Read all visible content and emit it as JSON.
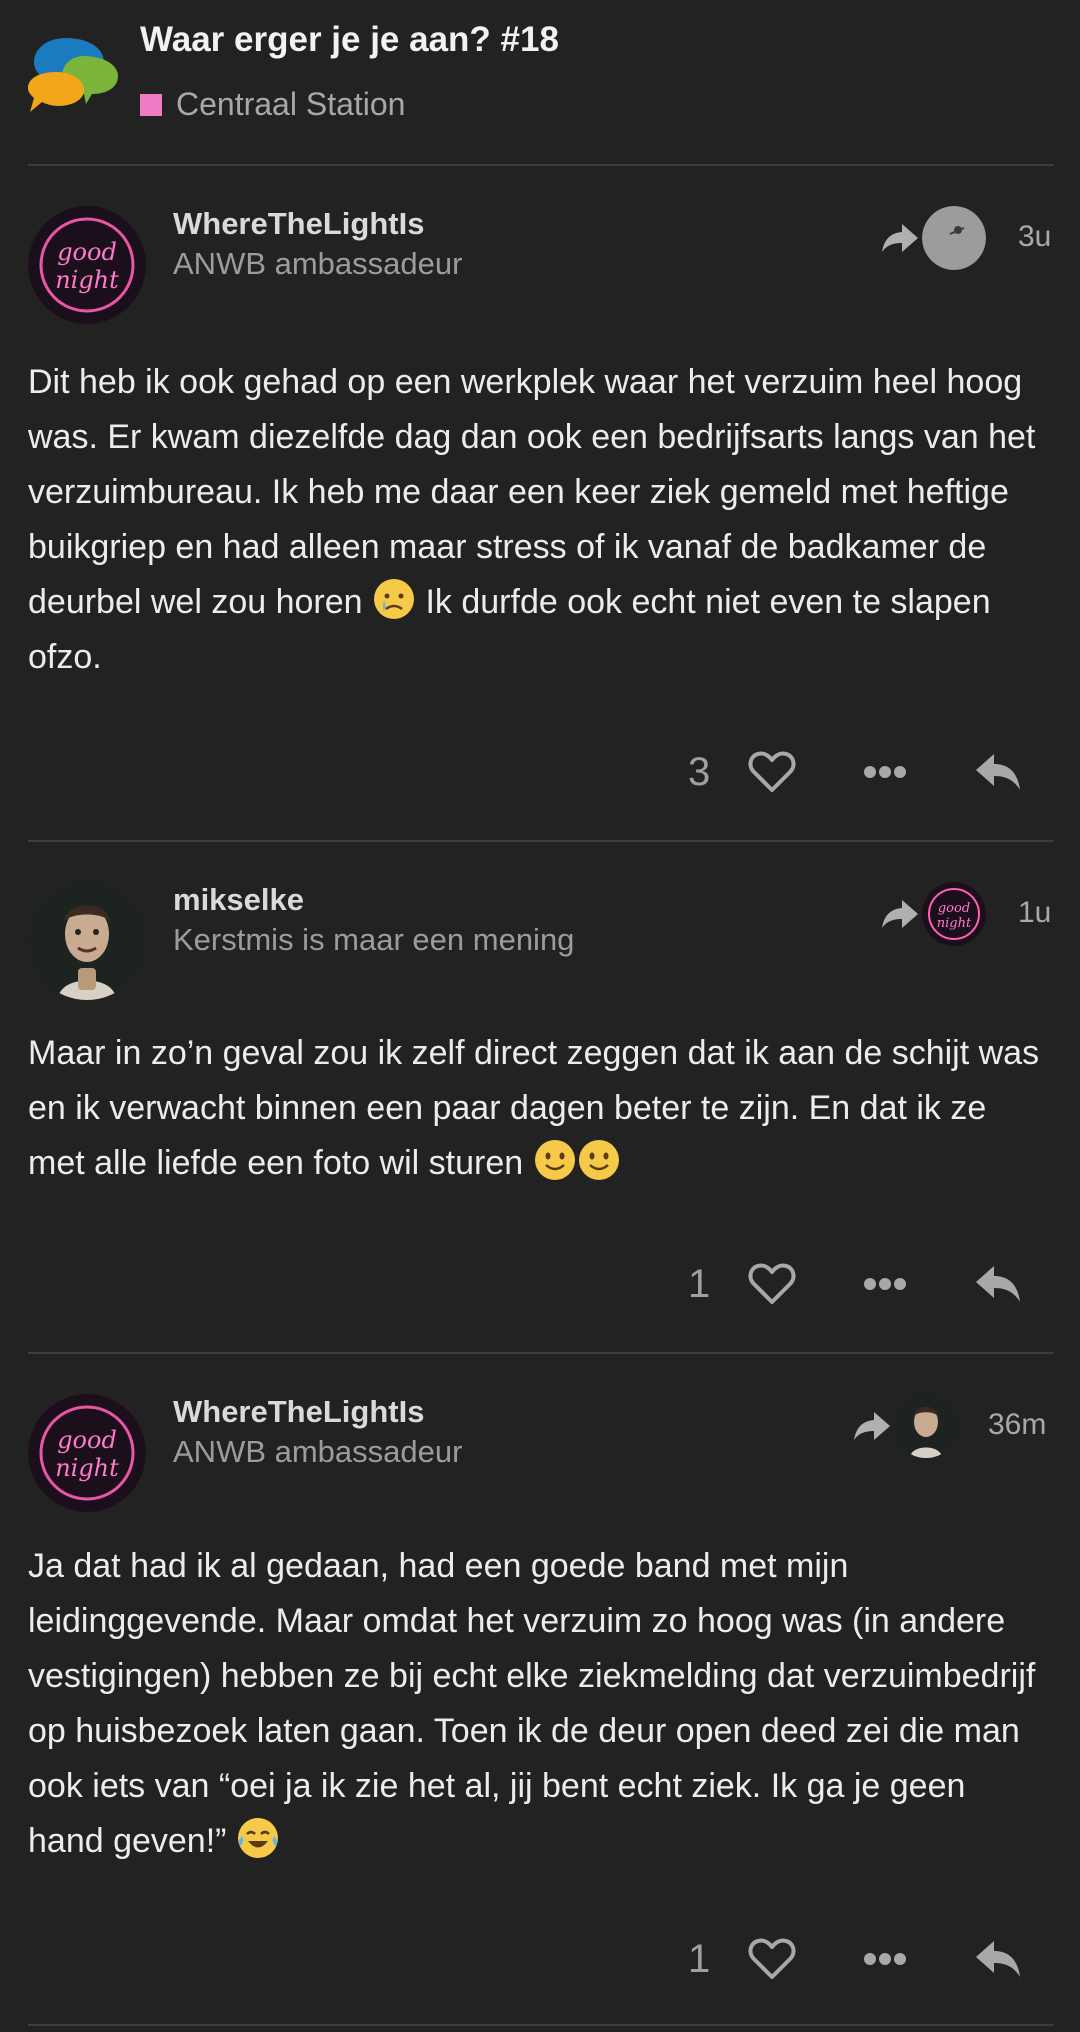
{
  "header": {
    "title": "Waar erger je je aan? #18",
    "category": "Centraal Station",
    "category_color": "#f07cc6",
    "logo_icon": "speech-bubbles-logo-icon"
  },
  "posts": [
    {
      "username": "WhereTheLightIs",
      "user_title": "ANWB ambassadeur",
      "avatar": "neon-good-night-avatar",
      "reply_to_avatar": "grey-avatar",
      "time": "3u",
      "body": "Dit heb ik ook gehad op een werkplek waar het verzuim heel hoog was. Er kwam diezelfde dag dan ook een bedrijfsarts langs van het verzuimbureau. Ik heb me daar een keer ziek gemeld met heftige buikgriep en had alleen maar stress of ik vanaf de badkamer de deurbel wel zou horen",
      "body_after_emoji": " Ik durfde ook echt niet even te slapen ofzo.",
      "emoji": "crying-face-emoji",
      "likes": "3"
    },
    {
      "username": "mikselke",
      "user_title": "Kerstmis is maar een mening",
      "avatar": "man-portrait-avatar",
      "reply_to_avatar": "neon-good-night-avatar",
      "time": "1u",
      "body": "Maar in zo’n geval zou ik zelf direct zeggen dat ik aan de schijt was en ik verwacht binnen een paar dagen beter te zijn. En dat ik ze met alle liefde een foto wil sturen",
      "emoji": "slightly-smiling-face-emoji",
      "likes": "1"
    },
    {
      "username": "WhereTheLightIs",
      "user_title": "ANWB ambassadeur",
      "avatar": "neon-good-night-avatar",
      "reply_to_avatar": "man-portrait-avatar",
      "time": "36m",
      "body": "Ja dat had ik al gedaan, had een goede band met mijn leidinggevende. Maar omdat het verzuim zo hoog was (in andere vestigingen) hebben ze bij echt elke ziekmelding dat verzuimbedrijf op huisbezoek laten gaan. Toen ik de deur open deed zei die man ook iets van “oei ja ik zie het al, jij bent echt ziek. Ik ga je geen hand geven!”",
      "emoji": "tears-of-joy-emoji",
      "likes": "1"
    }
  ]
}
